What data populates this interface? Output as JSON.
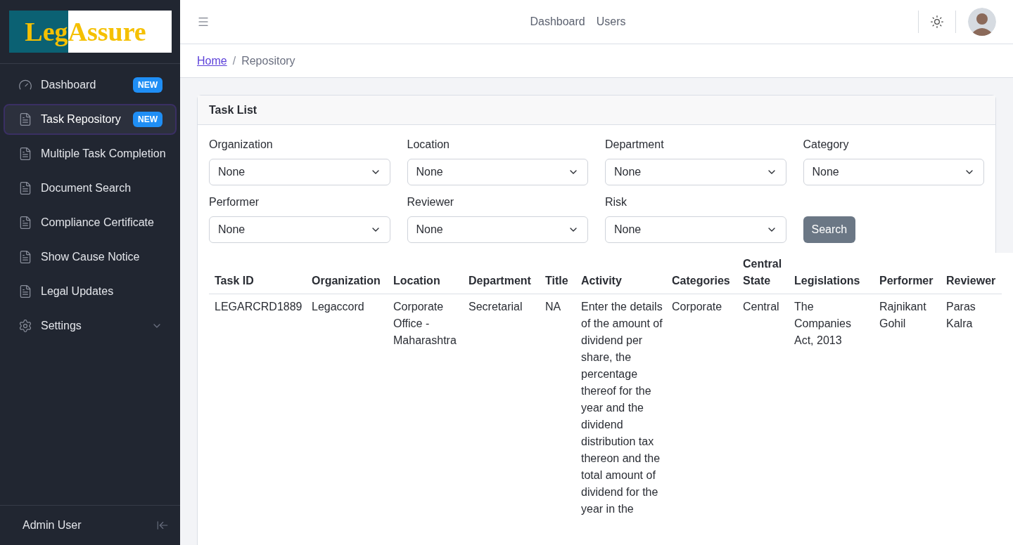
{
  "logo": {
    "part_1": "Leg",
    "part_2": "Assure"
  },
  "sidebar": {
    "items": [
      {
        "kind": "gauge",
        "label": "Dashboard",
        "badge": "NEW",
        "selected": false
      },
      {
        "kind": "doc",
        "label": "Task Repository",
        "badge": "NEW",
        "selected": true
      },
      {
        "kind": "doc",
        "label": "Multiple Task Completion",
        "selected": false
      },
      {
        "kind": "doc",
        "label": "Document Search",
        "selected": false
      },
      {
        "kind": "doc",
        "label": "Compliance Certificate",
        "selected": false
      },
      {
        "kind": "doc",
        "label": "Show Cause Notice",
        "selected": false
      },
      {
        "kind": "doc",
        "label": "Legal Updates",
        "selected": false
      },
      {
        "kind": "gear",
        "label": "Settings",
        "expandable": true,
        "selected": false
      }
    ],
    "footer": {
      "user": "Admin User"
    }
  },
  "header": {
    "nav": [
      "Dashboard",
      "Users"
    ]
  },
  "breadcrumb": [
    {
      "label": "Home",
      "link": true
    },
    {
      "separator": "/",
      "label": "Repository",
      "link": false
    }
  ],
  "card": {
    "title": "Task List",
    "filters": [
      {
        "label": "Organization",
        "value": "None"
      },
      {
        "label": "Location",
        "value": "None"
      },
      {
        "label": "Department",
        "value": "None"
      },
      {
        "label": "Category",
        "value": "None"
      },
      {
        "label": "Performer",
        "value": "None"
      },
      {
        "label": "Reviewer",
        "value": "None"
      },
      {
        "label": "Risk",
        "value": "None"
      }
    ],
    "search_button": "Search"
  },
  "table": {
    "columns": [
      "Task ID",
      "Organization",
      "Location",
      "Department",
      "Title",
      "Activity",
      "Categories",
      "Central State",
      "Legislations",
      "Performer",
      "Reviewer"
    ],
    "rows": [
      [
        "LEGARCRD1889",
        "Legaccord",
        "Corporate Office - Maharashtra",
        "Secretarial",
        "NA",
        "Enter the details of the amount of dividend per share, the percentage thereof for the year and the dividend distribution tax thereon and the total amount of dividend for the year in the",
        "Corporate",
        "Central",
        "The Companies Act, 2013",
        "Rajnikant Gohil",
        "Paras Kalra"
      ]
    ]
  }
}
